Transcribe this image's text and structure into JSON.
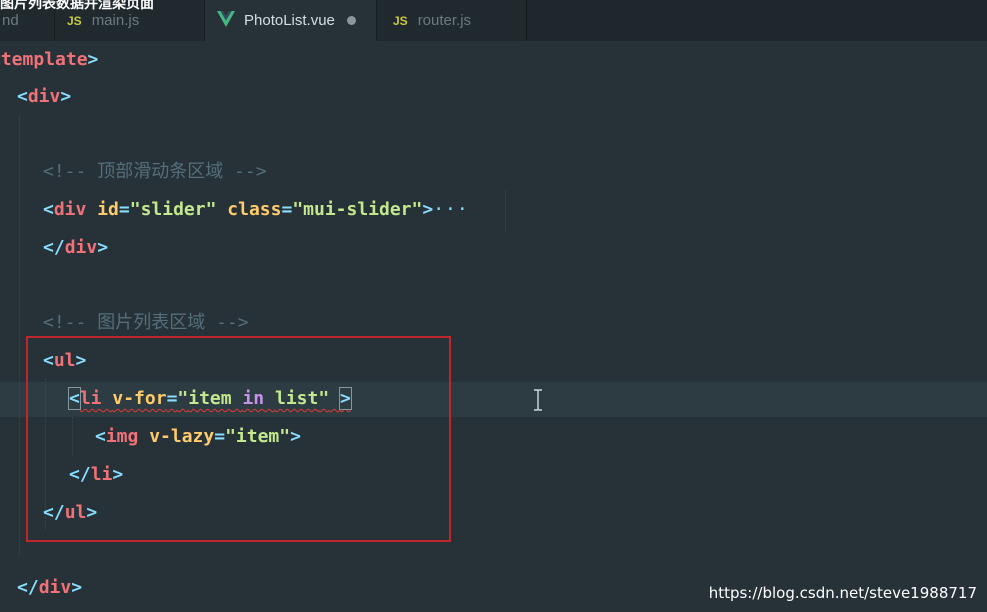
{
  "video_title": "图片列表数据并渲染页面",
  "tabs": [
    {
      "label": "nd",
      "icon": "",
      "active": false
    },
    {
      "label": "main.js",
      "icon": "JS",
      "active": false
    },
    {
      "label": "PhotoList.vue",
      "icon": "vue-logo-icon",
      "active": true,
      "modified": true
    },
    {
      "label": "router.js",
      "icon": "JS",
      "active": false
    }
  ],
  "colors": {
    "tag": "#f07178",
    "punctuation": "#89ddff",
    "attribute": "#ffcb6b",
    "string": "#c3e88d",
    "keyword": "#c792ea",
    "comment": "#546e7a",
    "vue_logo": "#42b883",
    "js_badge": "#cbcb41",
    "highlight_box": "#c0272d"
  },
  "code": {
    "template_tag": "template",
    "div_tag": "div",
    "comment_open": "<!--",
    "comment_close": "-->",
    "comment_slider": "顶部滑动条区域",
    "comment_photos": "图片列表区域",
    "slider_id_attr": "id",
    "slider_id_value": "\"slider\"",
    "slider_class_attr": "class",
    "slider_class_value": "\"mui-slider\"",
    "fold_marker": "···",
    "ul_tag": "ul",
    "li_tag": "li",
    "vfor_attr": "v-for",
    "vfor_open_quote": "\"",
    "vfor_item": "item",
    "vfor_in": "in",
    "vfor_list": "list",
    "vfor_close_quote": "\"",
    "img_tag": "img",
    "vlazy_attr": "v-lazy",
    "vlazy_value": "\"item\""
  },
  "watermark": "https://blog.csdn.net/steve1988717"
}
